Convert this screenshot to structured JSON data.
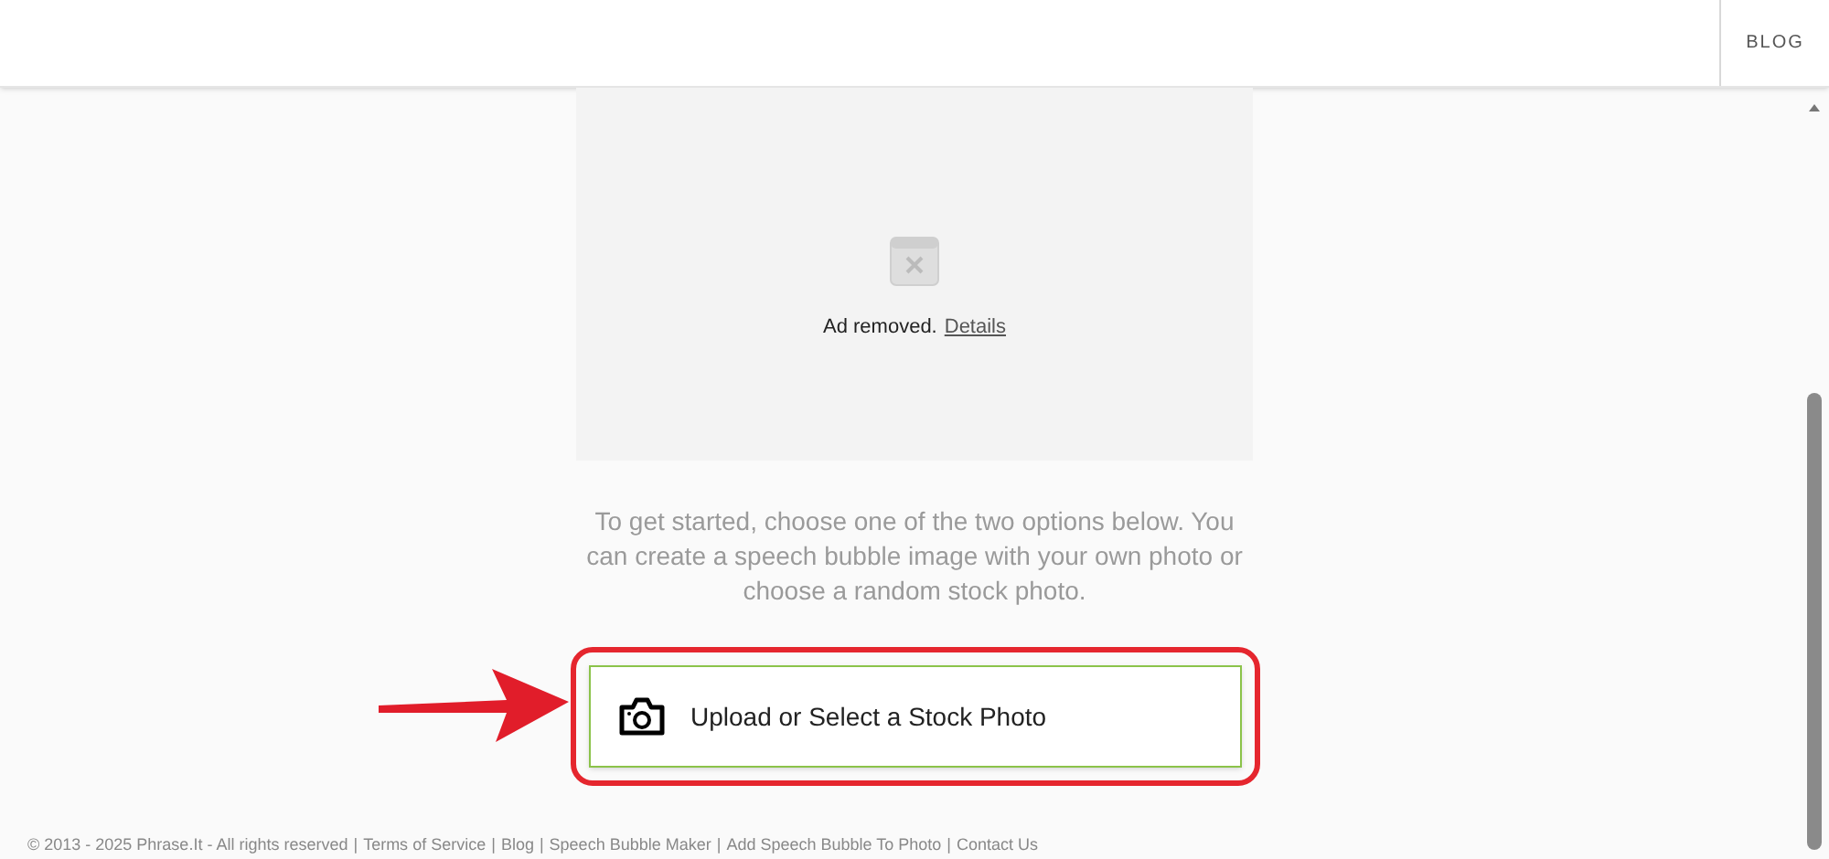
{
  "header": {
    "nav": [
      {
        "label": "BLOG"
      }
    ]
  },
  "ad": {
    "message": "Ad removed.",
    "link": "Details"
  },
  "intro": "To get started, choose one of the two options below. You can create a speech bubble image with your own photo or choose a random stock photo.",
  "upload_button": {
    "label": "Upload or Select a Stock Photo"
  },
  "footer": {
    "copyright": "© 2013 - 2025 Phrase.It - All rights reserved",
    "separator": "|",
    "links": [
      "Terms of Service",
      "Blog",
      "Speech Bubble Maker",
      "Add Speech Bubble To Photo",
      "Contact Us"
    ]
  }
}
